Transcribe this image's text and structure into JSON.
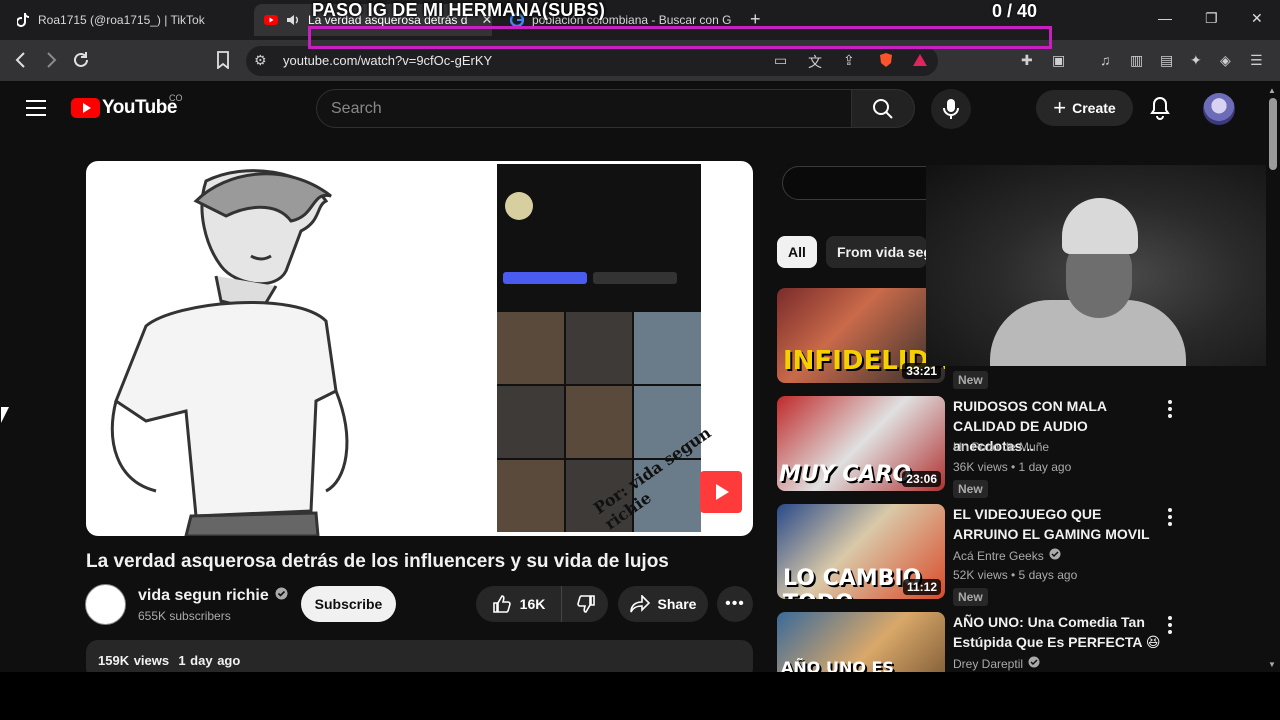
{
  "browser": {
    "tabs": [
      {
        "label": "Roa1715 (@roa1715_) | TikTok",
        "icon": "tiktok-icon"
      },
      {
        "label": "La verdad asquerosa detrás d",
        "icon": "youtube-icon"
      },
      {
        "label": "población colombiana - Buscar con G",
        "icon": "google-icon"
      }
    ],
    "url": "youtube.com/watch?v=9cfOc-gErKY"
  },
  "overlay": {
    "title": "PASO IG DE MI HERMANA(SUBS)",
    "counter": "0  / 40",
    "progress": 0.0
  },
  "youtube": {
    "logo_text": "YouTube",
    "region": "CO",
    "search_placeholder": "Search",
    "create_label": "Create"
  },
  "video": {
    "title": "La verdad asquerosa detrás de los influencers y su vida de lujos",
    "channel": "vida segun richie",
    "subscribers": "655K subscribers",
    "subscribe_label": "Subscribe",
    "likes": "16K",
    "share_label": "Share",
    "views": "159K views",
    "age": "1 day ago",
    "watermark": "Por: vida segun richie"
  },
  "sidebar": {
    "chips": [
      "All",
      "From vida seg"
    ],
    "recommendations": [
      {
        "title": "",
        "channel": "",
        "views": "",
        "duration": "33:21",
        "badge": "New",
        "thumb_text": "INFIDELIDAD"
      },
      {
        "title": "RUIDOSOS CON MALA CALIDAD DE AUDIO anecdotas...",
        "channel": "Un Poco de Muñe",
        "views": "36K views • 1 day ago",
        "duration": "23:06",
        "badge": "New",
        "thumb_text": "MUY CARO",
        "verified": false
      },
      {
        "title": "EL VIDEOJUEGO QUE ARRUINO EL GAMING MOVIL",
        "channel": "Acá Entre Geeks",
        "views": "52K views • 5 days ago",
        "duration": "11:12",
        "badge": "New",
        "thumb_text": "LO CAMBIO TODO",
        "verified": true
      },
      {
        "title": "AÑO UNO: Una Comedia Tan Estúpida Que Es PERFECTA 😆",
        "channel": "Drey Dareptil",
        "views": "",
        "duration": "",
        "badge": "",
        "thumb_text": "AÑO UNO ES",
        "verified": true
      }
    ]
  }
}
